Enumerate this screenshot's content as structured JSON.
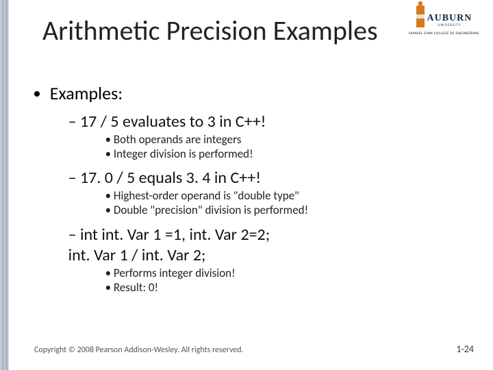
{
  "title": "Arithmetic Precision Examples",
  "logo": {
    "name": "AUBURN",
    "sub": "UNIVERSITY",
    "college": "SAMUEL GINN COLLEGE OF ENGINEERING"
  },
  "bullets": {
    "heading": "Examples:",
    "items": [
      {
        "head": "17 / 5  evaluates to 3 in C++!",
        "sub": [
          "Both operands are integers",
          "Integer division is performed!"
        ]
      },
      {
        "head": "17. 0 / 5 equals 3. 4 in C++!",
        "sub": [
          "Highest-order operand is \"double type\"",
          "Double \"precision\" division is performed!"
        ]
      },
      {
        "head": "int int. Var 1 =1, int. Var 2=2;",
        "head2": "int. Var 1 / int. Var 2;",
        "sub": [
          "Performs integer division!",
          "Result: 0!"
        ]
      }
    ]
  },
  "footer": {
    "copyright": "Copyright © 2008 Pearson Addison-Wesley. All rights reserved.",
    "page": "1-24"
  }
}
